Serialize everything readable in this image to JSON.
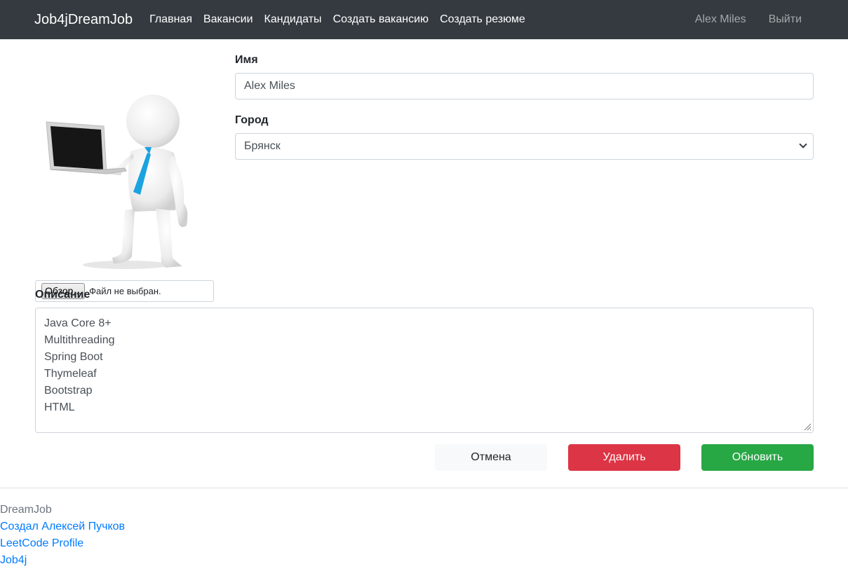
{
  "navbar": {
    "brand": "Job4jDreamJob",
    "links": [
      "Главная",
      "Вакансии",
      "Кандидаты",
      "Создать вакансию",
      "Создать резюме"
    ],
    "user": "Alex Miles",
    "logout": "Выйти"
  },
  "photo": {
    "file_button": "Обзор...",
    "file_status": "Файл не выбран."
  },
  "form": {
    "name_label": "Имя",
    "name_value": "Alex Miles",
    "city_label": "Город",
    "city_value": "Брянск",
    "description_label": "Описание",
    "description_lines": [
      "Java Core 8+",
      "Multithreading",
      "Spring Boot",
      "Thymeleaf",
      "Bootstrap",
      "HTML"
    ]
  },
  "actions": {
    "cancel": "Отмена",
    "delete": "Удалить",
    "update": "Обновить"
  },
  "footer": {
    "brand": "DreamJob",
    "links": [
      "Создал Алексей Пучков",
      "LeetCode Profile",
      "Job4j"
    ]
  },
  "colors": {
    "navbar": "#343a40",
    "danger": "#dc3545",
    "success": "#28a745",
    "link": "#007bff",
    "tie": "#1aa3e0"
  },
  "icons": [
    "chevron-down-icon",
    "resize-grip-icon"
  ]
}
